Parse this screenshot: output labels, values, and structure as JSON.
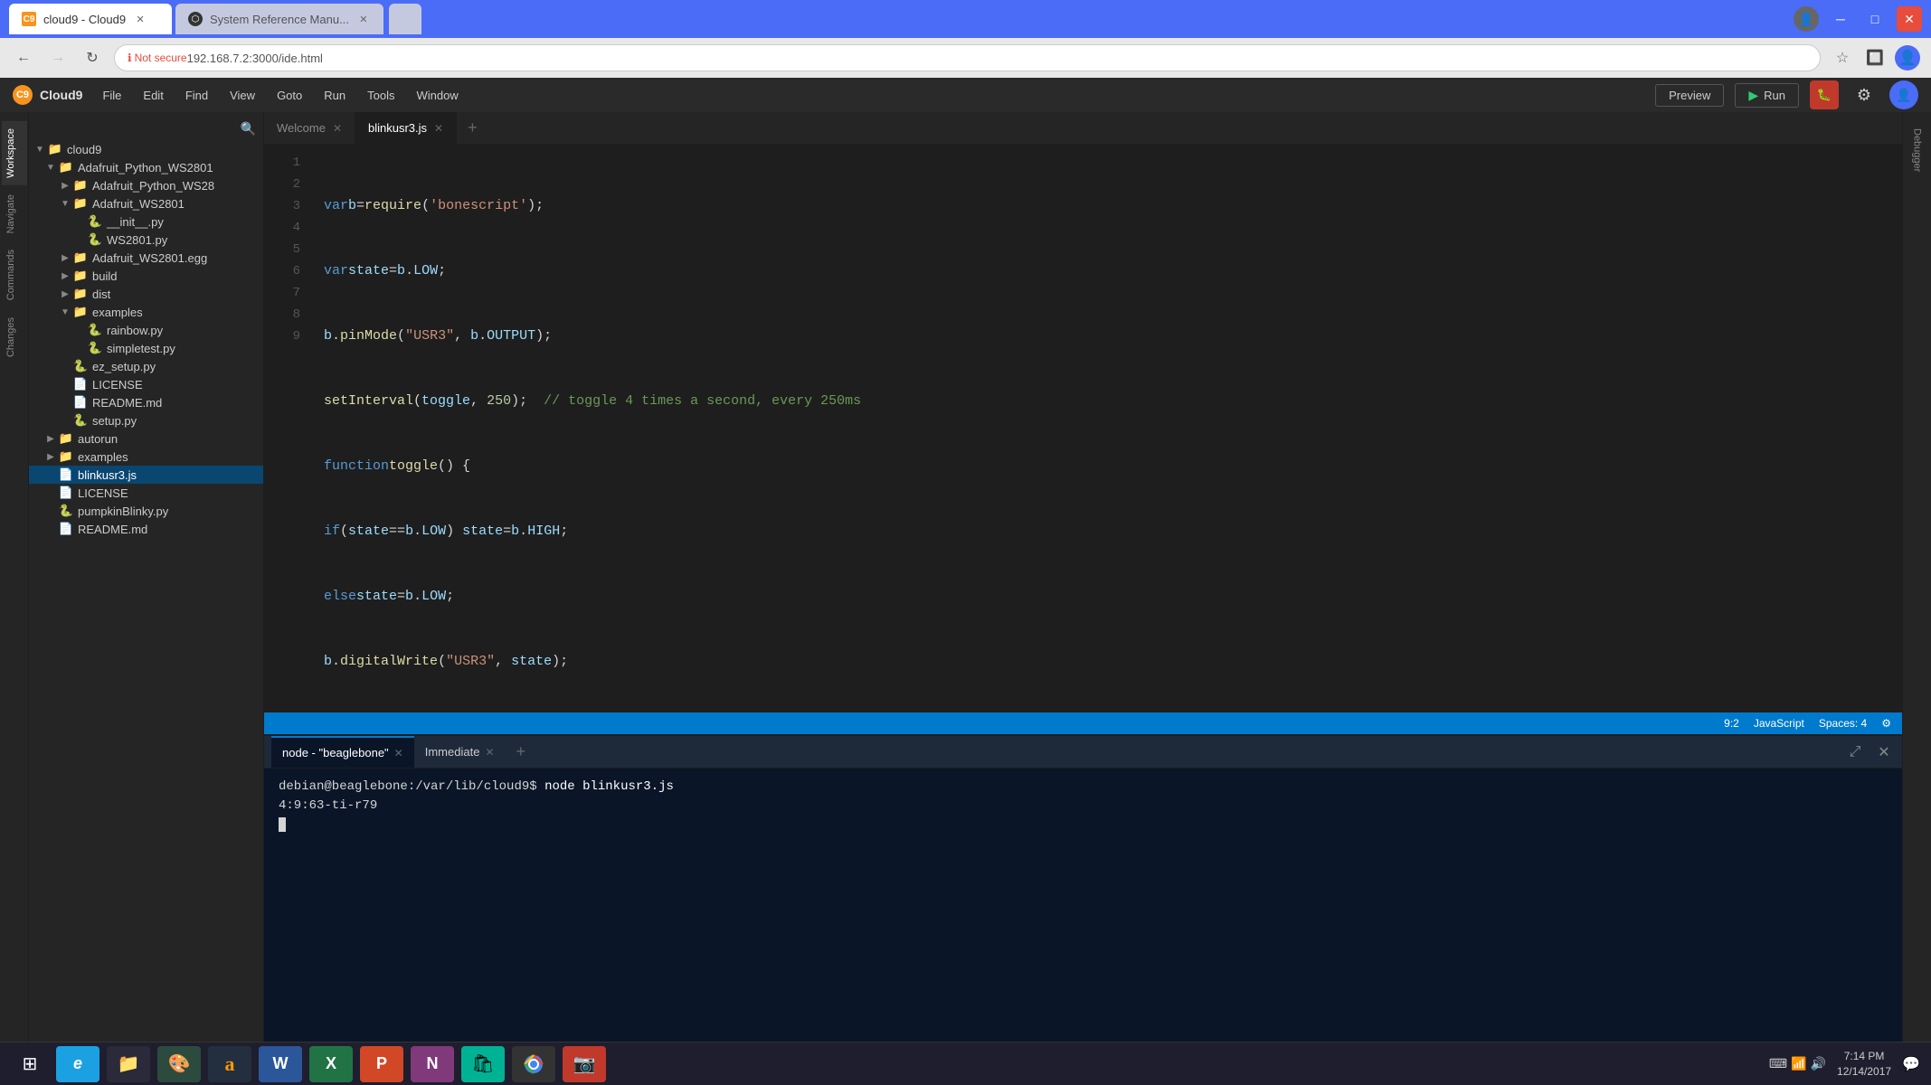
{
  "browser": {
    "title": "Cloud9 - Cloud9",
    "tabs": [
      {
        "id": "tab1",
        "label": "cloud9 - Cloud9",
        "active": true,
        "favicon": "C9"
      },
      {
        "id": "tab2",
        "label": "System Reference Manu...",
        "active": false,
        "favicon": "GH"
      }
    ],
    "address": "192.168.7.2:3000/ide.html",
    "protocol": "Not secure"
  },
  "c9menu": {
    "brand": "Cloud9",
    "items": [
      "File",
      "Edit",
      "Find",
      "View",
      "Goto",
      "Run",
      "Tools",
      "Window"
    ],
    "preview_label": "Preview",
    "run_label": "Run"
  },
  "sidebar": {
    "tabs": [
      "Workspace",
      "Navigate",
      "Commands",
      "Changes"
    ]
  },
  "filetree": {
    "root": "cloud9",
    "items": [
      {
        "type": "folder",
        "name": "Adafruit_Python_WS2801",
        "level": 1,
        "expanded": true
      },
      {
        "type": "folder",
        "name": "Adafruit_Python_WS28",
        "level": 2,
        "expanded": false
      },
      {
        "type": "folder",
        "name": "Adafruit_WS2801",
        "level": 2,
        "expanded": true
      },
      {
        "type": "file",
        "name": "__init__.py",
        "level": 3,
        "ext": "py"
      },
      {
        "type": "file",
        "name": "WS2801.py",
        "level": 3,
        "ext": "py"
      },
      {
        "type": "folder",
        "name": "Adafruit_WS2801.egg",
        "level": 2,
        "expanded": false
      },
      {
        "type": "folder",
        "name": "build",
        "level": 2,
        "expanded": false
      },
      {
        "type": "folder",
        "name": "dist",
        "level": 2,
        "expanded": false
      },
      {
        "type": "folder",
        "name": "examples",
        "level": 2,
        "expanded": true
      },
      {
        "type": "file",
        "name": "rainbow.py",
        "level": 3,
        "ext": "py"
      },
      {
        "type": "file",
        "name": "simpletest.py",
        "level": 3,
        "ext": "py"
      },
      {
        "type": "file",
        "name": "ez_setup.py",
        "level": 2,
        "ext": "py"
      },
      {
        "type": "file",
        "name": "LICENSE",
        "level": 2,
        "ext": "txt"
      },
      {
        "type": "file",
        "name": "README.md",
        "level": 2,
        "ext": "md"
      },
      {
        "type": "file",
        "name": "setup.py",
        "level": 2,
        "ext": "py"
      },
      {
        "type": "folder",
        "name": "autorun",
        "level": 1,
        "expanded": false
      },
      {
        "type": "folder",
        "name": "examples",
        "level": 1,
        "expanded": false
      },
      {
        "type": "file",
        "name": "blinkusr3.js",
        "level": 1,
        "ext": "js",
        "selected": true
      },
      {
        "type": "file",
        "name": "LICENSE",
        "level": 1,
        "ext": "txt"
      },
      {
        "type": "file",
        "name": "pumpkinBlinky.py",
        "level": 1,
        "ext": "py"
      },
      {
        "type": "file",
        "name": "README.md",
        "level": 1,
        "ext": "md"
      }
    ]
  },
  "editor": {
    "tabs": [
      {
        "id": "welcome",
        "label": "Welcome",
        "active": false
      },
      {
        "id": "blinkusr3",
        "label": "blinkusr3.js",
        "active": true
      }
    ],
    "code_lines": [
      {
        "num": 1,
        "code": "var b = require('bonescript');"
      },
      {
        "num": 2,
        "code": "var state = b.LOW;"
      },
      {
        "num": 3,
        "code": "b.pinMode(\"USR3\", b.OUTPUT);"
      },
      {
        "num": 4,
        "code": "setInterval(toggle, 250);  // toggle 4 times a second, every 250ms"
      },
      {
        "num": 5,
        "code": "function toggle() {"
      },
      {
        "num": 6,
        "code": "    if(state == b.LOW) state = b.HIGH;"
      },
      {
        "num": 7,
        "code": "    else state = b.LOW;"
      },
      {
        "num": 8,
        "code": "    b.digitalWrite(\"USR3\", state);"
      },
      {
        "num": 9,
        "code": "}"
      }
    ],
    "status": {
      "position": "9:2",
      "language": "JavaScript",
      "indent": "Spaces: 4"
    }
  },
  "terminal": {
    "tabs": [
      {
        "id": "node-tab",
        "label": "node - \"beaglebone\"",
        "active": true
      },
      {
        "id": "immediate-tab",
        "label": "Immediate",
        "active": false
      }
    ],
    "content": {
      "prompt": "debian@beaglebone:/var/lib/cloud9$",
      "command": "node blinkusr3.js",
      "output": "4:9:63-ti-r79"
    }
  },
  "taskbar": {
    "apps": [
      {
        "name": "windows-start",
        "symbol": "⊞"
      },
      {
        "name": "internet-explorer",
        "symbol": "e",
        "color": "#1ba1e2"
      },
      {
        "name": "file-explorer",
        "symbol": "📁"
      },
      {
        "name": "app3",
        "symbol": "🎨"
      },
      {
        "name": "amazon",
        "symbol": "a",
        "color": "#ff9900"
      },
      {
        "name": "word",
        "symbol": "W",
        "color": "#2b579a"
      },
      {
        "name": "excel",
        "symbol": "X",
        "color": "#217346"
      },
      {
        "name": "powerpoint",
        "symbol": "P",
        "color": "#d24726"
      },
      {
        "name": "onenote",
        "symbol": "N",
        "color": "#80397b"
      },
      {
        "name": "store",
        "symbol": "🛍"
      },
      {
        "name": "chrome",
        "symbol": "◎"
      },
      {
        "name": "camera",
        "symbol": "📷"
      }
    ],
    "time": "7:14 PM",
    "date": "12/14/2017"
  },
  "right_sidebar": {
    "label": "Debugger"
  }
}
